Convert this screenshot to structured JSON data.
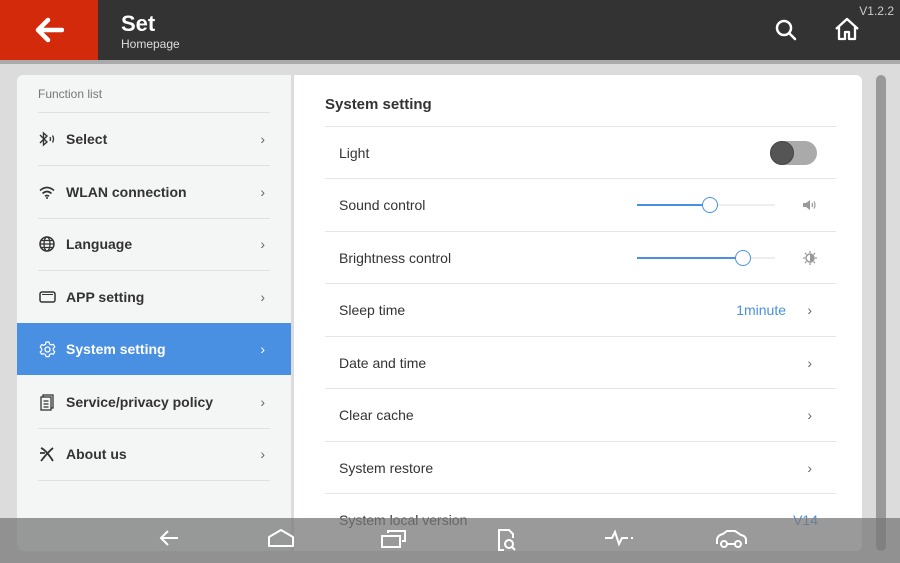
{
  "header": {
    "title": "Set",
    "subtitle": "Homepage",
    "version": "V1.2.2",
    "back_icon": "arrow-left-icon",
    "search_icon": "search-icon",
    "home_icon": "home-icon",
    "brand_color": "#d42a0c"
  },
  "sidebar": {
    "heading": "Function list",
    "items": [
      {
        "label": "Select",
        "icon": "bluetooth-icon",
        "selected": false
      },
      {
        "label": "WLAN connection",
        "icon": "wifi-icon",
        "selected": false
      },
      {
        "label": "Language",
        "icon": "globe-icon",
        "selected": false
      },
      {
        "label": "APP setting",
        "icon": "app-icon",
        "selected": false
      },
      {
        "label": "System setting",
        "icon": "gear-icon",
        "selected": true
      },
      {
        "label": "Service/privacy policy",
        "icon": "document-icon",
        "selected": false
      },
      {
        "label": "About us",
        "icon": "x-logo-icon",
        "selected": false
      }
    ],
    "accent": "#4a90e2"
  },
  "main": {
    "title": "System setting",
    "rows": [
      {
        "label": "Light",
        "toggle_on": false
      },
      {
        "label": "Sound control",
        "slider_value": 0.53
      },
      {
        "label": "Brightness control",
        "slider_value": 0.77
      },
      {
        "label": "Sleep time",
        "value": "1minute"
      },
      {
        "label": "Date and time"
      },
      {
        "label": "Clear cache"
      },
      {
        "label": "System restore"
      },
      {
        "label": "System local version",
        "value": "V14"
      }
    ]
  },
  "navbar": {
    "icons": [
      "back-icon",
      "home-icon",
      "recents-icon",
      "diagnose-search-icon",
      "pulse-icon",
      "car-icon"
    ]
  }
}
